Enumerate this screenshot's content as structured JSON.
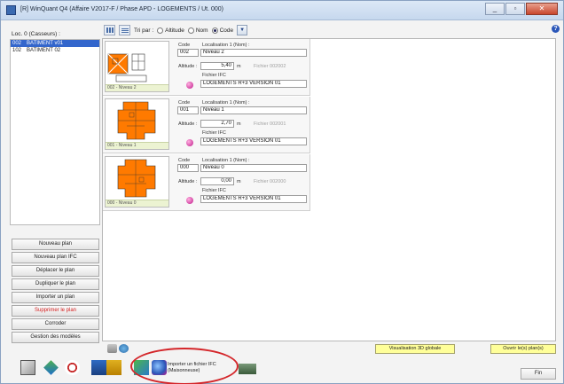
{
  "window": {
    "title": "[R] WinQuant Q4  (Affaire V2017-F / Phase APD - LOGEMENTS / Ut. 000)",
    "minimize": "_",
    "maximize": "▫",
    "close": "✕"
  },
  "left": {
    "loc_label": "Loc. 0 (Casseurs) :",
    "locations": [
      {
        "code": "002",
        "name": "BATIMENT v01",
        "selected": true
      },
      {
        "code": "102",
        "name": "BATIMENT 02",
        "selected": false
      }
    ],
    "buttons": {
      "new_plan": "Nouveau plan",
      "new_plan_ifc": "Nouveau plan IFC",
      "move_plan": "Déplacer le plan",
      "duplicate_plan": "Dupliquer le plan",
      "import_plan": "Importer un plan",
      "delete_plan": "Supprimer le plan",
      "calibrate": "Corroder",
      "manage_models": "Gestion des modèles"
    }
  },
  "toolbar": {
    "sort_label": "Tri par :",
    "opt_altitude": "Altitude",
    "opt_nom": "Nom",
    "opt_code": "Code",
    "selected": "Code"
  },
  "plans": [
    {
      "caption": "002 - Niveau 2",
      "code_label": "Code",
      "code": "002",
      "loc_label": "Localisation 1 (Nom) :",
      "loc": "Niveau 2",
      "alt_label": "Altitude :",
      "altitude": "5,40",
      "unit": "m",
      "file_label": "Fichier 002002",
      "ifc_label": "Fichier IFC",
      "ifc": "LOGEMENTS R+3 VERSION 01"
    },
    {
      "caption": "001 - Niveau 1",
      "code_label": "Code",
      "code": "001",
      "loc_label": "Localisation 1 (Nom) :",
      "loc": "Niveau 1",
      "alt_label": "Altitude :",
      "altitude": "2,70",
      "unit": "m",
      "file_label": "Fichier 002001",
      "ifc_label": "Fichier IFC",
      "ifc": "LOGEMENTS R+3 VERSION 01"
    },
    {
      "caption": "000 - Niveau 0",
      "code_label": "Code",
      "code": "000",
      "loc_label": "Localisation 1 (Nom) :",
      "loc": "Niveau 0",
      "alt_label": "Altitude :",
      "altitude": "0,00",
      "unit": "m",
      "file_label": "Fichier 002000",
      "ifc_label": "Fichier IFC",
      "ifc": "LOGEMENTS R+3 VERSION 01"
    }
  ],
  "bottom": {
    "visu3d": "Visualisation 3D globale",
    "open_plans": "Ouvrir le(s) plan(s)",
    "import_ifc_line1": "Importer un fichier IFC",
    "import_ifc_line2": "(Maisonneuse)",
    "fin": "Fin"
  },
  "colors": {
    "accent": "#3366cc",
    "plan_orange": "#ff7a00",
    "highlight_red": "#d4262a",
    "yellow_button": "#ffff99"
  }
}
